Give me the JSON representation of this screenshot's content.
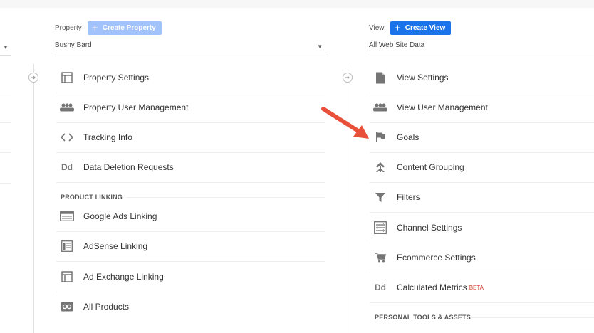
{
  "property": {
    "header_label": "Property",
    "create_button": "Create Property",
    "selected": "Bushy Bard",
    "items": [
      {
        "label": "Property Settings",
        "icon": "settings-window-icon"
      },
      {
        "label": "Property User Management",
        "icon": "people-icon"
      },
      {
        "label": "Tracking Info",
        "icon": "code-icon"
      },
      {
        "label": "Data Deletion Requests",
        "icon": "dd-icon"
      }
    ],
    "section_title": "PRODUCT LINKING",
    "linking": [
      {
        "label": "Google Ads Linking",
        "icon": "google-ads-icon"
      },
      {
        "label": "AdSense Linking",
        "icon": "adsense-icon"
      },
      {
        "label": "Ad Exchange Linking",
        "icon": "ad-exchange-icon"
      },
      {
        "label": "All Products",
        "icon": "all-products-icon"
      }
    ]
  },
  "view": {
    "header_label": "View",
    "create_button": "Create View",
    "selected": "All Web Site Data",
    "items": [
      {
        "label": "View Settings",
        "icon": "document-icon"
      },
      {
        "label": "View User Management",
        "icon": "people-icon"
      },
      {
        "label": "Goals",
        "icon": "flag-icon"
      },
      {
        "label": "Content Grouping",
        "icon": "content-grouping-icon"
      },
      {
        "label": "Filters",
        "icon": "filter-icon"
      },
      {
        "label": "Channel Settings",
        "icon": "channel-settings-icon"
      },
      {
        "label": "Ecommerce Settings",
        "icon": "cart-icon"
      },
      {
        "label": "Calculated Metrics",
        "icon": "dd-icon",
        "badge": "BETA"
      }
    ],
    "section_title": "PERSONAL TOOLS & ASSETS"
  },
  "colors": {
    "primary_button": "#1a73e8",
    "disabled_button": "#a1c2fa",
    "arrow": "#e8503a",
    "icon": "#757575",
    "beta": "#d23f31"
  }
}
